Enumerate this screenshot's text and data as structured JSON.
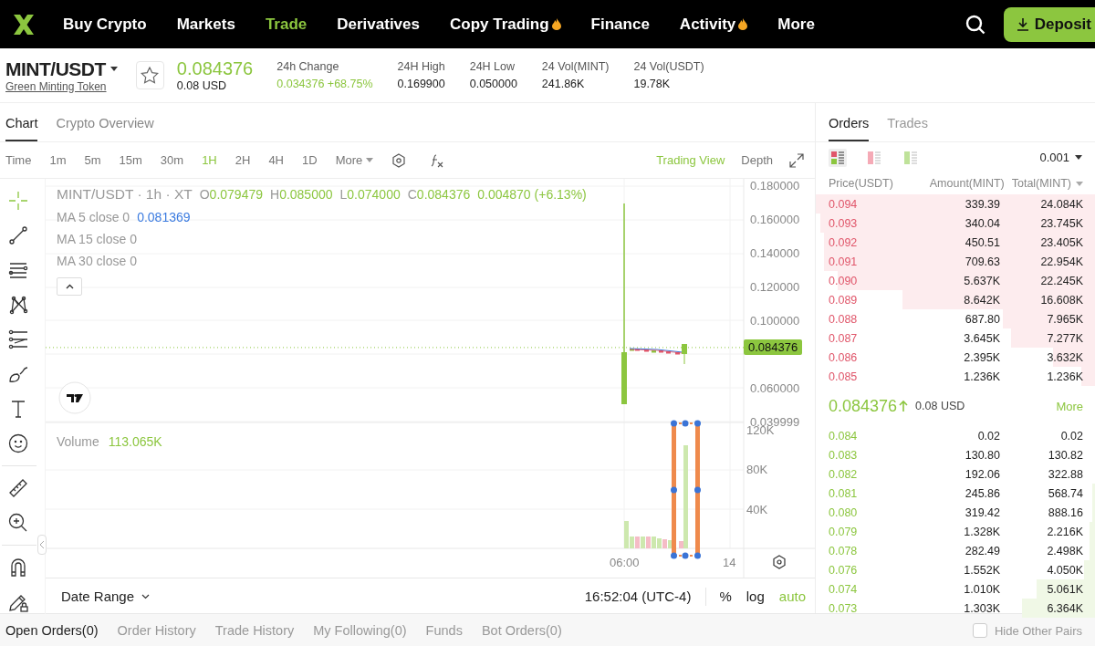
{
  "nav": {
    "items": [
      {
        "label": "Buy Crypto",
        "selected": false,
        "hot": false
      },
      {
        "label": "Markets",
        "selected": false,
        "hot": false
      },
      {
        "label": "Trade",
        "selected": true,
        "hot": false
      },
      {
        "label": "Derivatives",
        "selected": false,
        "hot": false
      },
      {
        "label": "Copy Trading",
        "selected": false,
        "hot": true
      },
      {
        "label": "Finance",
        "selected": false,
        "hot": false
      },
      {
        "label": "Activity",
        "selected": false,
        "hot": true
      },
      {
        "label": "More",
        "selected": false,
        "hot": false
      }
    ],
    "deposit": "Deposit"
  },
  "ticker": {
    "pair": "MINT/USDT",
    "name": "Green Minting Token",
    "price": "0.084376",
    "price_usd": "0.08 USD",
    "favorite": false,
    "stats": [
      {
        "label": "24h Change",
        "value": "0.034376 +68.75%",
        "positive": true
      },
      {
        "label": "24H High",
        "value": "0.169900",
        "positive": false
      },
      {
        "label": "24H Low",
        "value": "0.050000",
        "positive": false
      },
      {
        "label": "24 Vol(MINT)",
        "value": "241.86K",
        "positive": false
      },
      {
        "label": "24 Vol(USDT)",
        "value": "19.78K",
        "positive": false
      }
    ]
  },
  "chart_panel": {
    "tabs": [
      {
        "label": "Chart",
        "selected": true
      },
      {
        "label": "Crypto Overview",
        "selected": false
      }
    ],
    "intervals": [
      {
        "label": "Time",
        "selected": false
      },
      {
        "label": "1m",
        "selected": false
      },
      {
        "label": "5m",
        "selected": false
      },
      {
        "label": "15m",
        "selected": false
      },
      {
        "label": "30m",
        "selected": false
      },
      {
        "label": "1H",
        "selected": true
      },
      {
        "label": "2H",
        "selected": false
      },
      {
        "label": "4H",
        "selected": false
      },
      {
        "label": "1D",
        "selected": false
      }
    ],
    "more": "More",
    "views": [
      {
        "label": "Trading View",
        "selected": true
      },
      {
        "label": "Depth",
        "selected": false
      }
    ],
    "tool_groups": [
      {
        "tools": [
          {
            "kind": "crosshair",
            "selected": true
          },
          {
            "kind": "trend-line",
            "selected": false
          },
          {
            "kind": "horizontal-lines",
            "selected": false
          },
          {
            "kind": "pattern",
            "selected": false
          },
          {
            "kind": "fib",
            "selected": false
          },
          {
            "kind": "brush",
            "selected": false
          },
          {
            "kind": "text",
            "selected": false
          },
          {
            "kind": "emoji",
            "selected": false
          }
        ]
      },
      {
        "tools": [
          {
            "kind": "ruler",
            "selected": false
          },
          {
            "kind": "zoom",
            "selected": false
          }
        ]
      },
      {
        "tools": [
          {
            "kind": "magnet",
            "selected": false
          },
          {
            "kind": "lock-draw",
            "selected": false
          }
        ]
      }
    ],
    "legend": {
      "title": "MINT/USDT · 1h · XT",
      "ohlc": [
        {
          "key": "O",
          "value": "0.079479"
        },
        {
          "key": "H",
          "value": "0.085000"
        },
        {
          "key": "L",
          "value": "0.074000"
        },
        {
          "key": "C",
          "value": "0.084376"
        }
      ],
      "change": "0.004870 (+6.13%)",
      "ma": [
        {
          "label": "MA 5 close 0",
          "value": "0.081369"
        },
        {
          "label": "MA 15 close 0"
        },
        {
          "label": "MA 30 close 0"
        }
      ],
      "volume_label": "Volume",
      "volume_value": "113.065K"
    },
    "price_ticks": [
      "0.180000",
      "0.160000",
      "0.140000",
      "0.120000",
      "0.100000",
      "0.060000",
      "0.039999"
    ],
    "last_price": "0.084376",
    "volume_ticks": [
      "120K",
      "80K",
      "40K"
    ],
    "time_ticks": [
      "06:00",
      "14"
    ],
    "footer": {
      "date_range": "Date Range",
      "clock": "16:52:04 (UTC-4)",
      "percent": "%",
      "log": "log",
      "auto": "auto",
      "auto_on": true
    }
  },
  "order_book": {
    "tabs": [
      {
        "label": "Orders",
        "selected": true
      },
      {
        "label": "Trades",
        "selected": false
      }
    ],
    "views": [
      {
        "kind": "both",
        "selected": true
      },
      {
        "kind": "asks",
        "selected": false
      },
      {
        "kind": "bids",
        "selected": false
      }
    ],
    "precision": "0.001",
    "columns": [
      "Price(USDT)",
      "Amount(MINT)",
      "Total(MINT)"
    ],
    "asks": [
      {
        "price": "0.094",
        "amount": "339.39",
        "total": "24.084K",
        "level": 1
      },
      {
        "price": "0.093",
        "amount": "340.04",
        "total": "23.745K",
        "level": 0.985
      },
      {
        "price": "0.092",
        "amount": "450.51",
        "total": "23.405K",
        "level": 0.97
      },
      {
        "price": "0.091",
        "amount": "709.63",
        "total": "22.954K",
        "level": 0.97
      },
      {
        "price": "0.090",
        "amount": "5.637K",
        "total": "22.245K",
        "level": 0.92
      },
      {
        "price": "0.089",
        "amount": "8.642K",
        "total": "16.608K",
        "level": 0.69
      },
      {
        "price": "0.088",
        "amount": "687.80",
        "total": "7.965K",
        "level": 0.33
      },
      {
        "price": "0.087",
        "amount": "3.645K",
        "total": "7.277K",
        "level": 0.3
      },
      {
        "price": "0.086",
        "amount": "2.395K",
        "total": "3.632K",
        "level": 0.15
      },
      {
        "price": "0.085",
        "amount": "1.236K",
        "total": "1.236K",
        "level": 0.05
      }
    ],
    "mid": {
      "price": "0.084376",
      "usd": "0.08 USD",
      "more": "More"
    },
    "bids": [
      {
        "price": "0.084",
        "amount": "0.02",
        "total": "0.02",
        "level": 0
      },
      {
        "price": "0.083",
        "amount": "130.80",
        "total": "130.82",
        "level": 0
      },
      {
        "price": "0.082",
        "amount": "192.06",
        "total": "322.88",
        "level": 0
      },
      {
        "price": "0.081",
        "amount": "245.86",
        "total": "568.74",
        "level": 0.01
      },
      {
        "price": "0.080",
        "amount": "319.42",
        "total": "888.16",
        "level": 0.01
      },
      {
        "price": "0.079",
        "amount": "1.328K",
        "total": "2.216K",
        "level": 0.02
      },
      {
        "price": "0.078",
        "amount": "282.49",
        "total": "2.498K",
        "level": 0.02
      },
      {
        "price": "0.076",
        "amount": "1.552K",
        "total": "4.050K",
        "level": 0.04
      },
      {
        "price": "0.074",
        "amount": "1.010K",
        "total": "5.061K",
        "level": 0.21
      },
      {
        "price": "0.073",
        "amount": "1.303K",
        "total": "6.364K",
        "level": 0.26
      }
    ]
  },
  "bottom_tabs": {
    "tabs": [
      {
        "label": "Open Orders(0)",
        "selected": true
      },
      {
        "label": "Order History",
        "selected": false
      },
      {
        "label": "Trade History",
        "selected": false
      },
      {
        "label": "My Following(0)",
        "selected": false
      },
      {
        "label": "Funds",
        "selected": false
      },
      {
        "label": "Bot Orders(0)",
        "selected": false
      }
    ],
    "hide_other_pairs": {
      "label": "Hide Other Pairs",
      "checked": false
    }
  }
}
